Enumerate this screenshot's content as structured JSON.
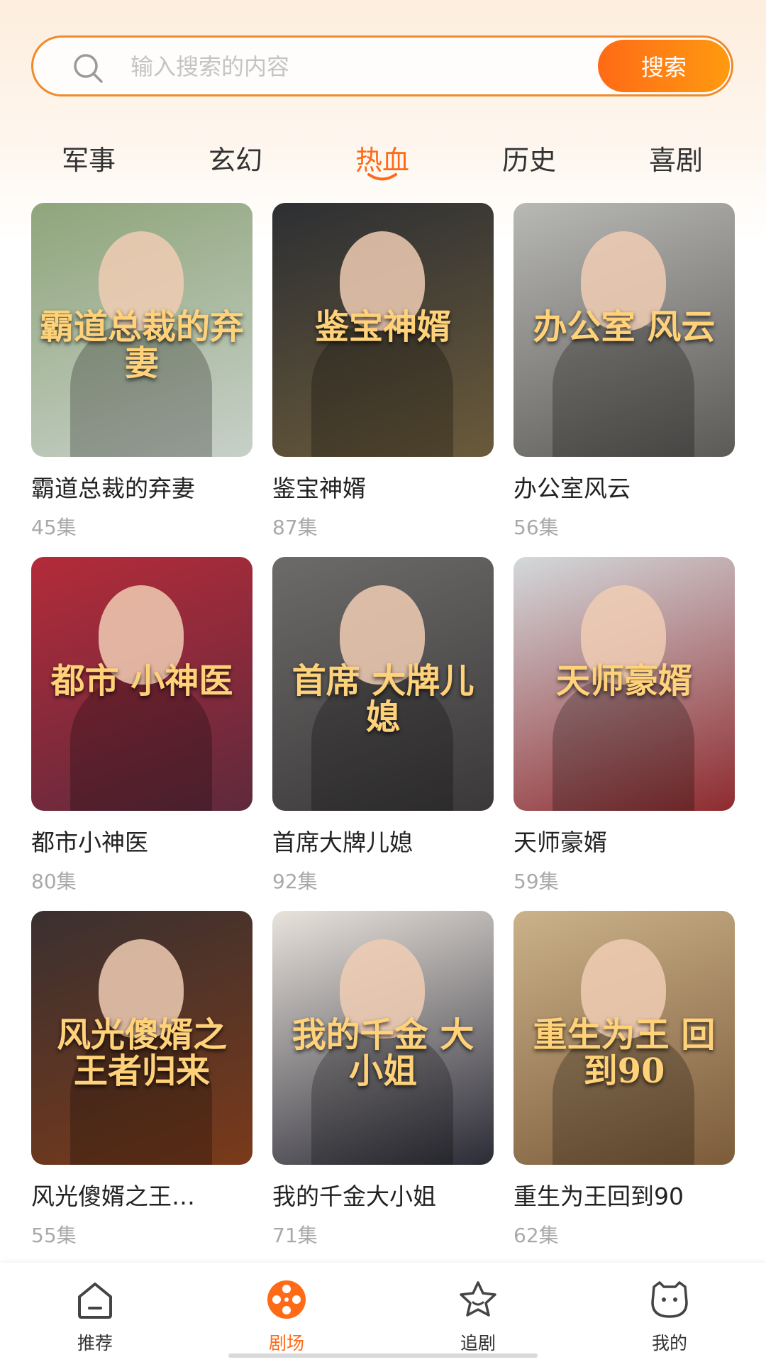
{
  "search": {
    "placeholder": "输入搜索的内容",
    "button_label": "搜索"
  },
  "tabs": [
    {
      "label": "军事",
      "active": false
    },
    {
      "label": "玄幻",
      "active": false
    },
    {
      "label": "热血",
      "active": true
    },
    {
      "label": "历史",
      "active": false
    },
    {
      "label": "喜剧",
      "active": false
    }
  ],
  "dramas": [
    {
      "title": "霸道总裁的弃妻",
      "episodes": "45集",
      "poster_text": "霸道总裁的弃妻",
      "poster_colors": [
        "#8fa57b",
        "#c7d0c8"
      ]
    },
    {
      "title": "鉴宝神婿",
      "episodes": "87集",
      "poster_text": "鉴宝神婿",
      "poster_colors": [
        "#2d2f33",
        "#6a5a3a"
      ]
    },
    {
      "title": "办公室风云",
      "episodes": "56集",
      "poster_text": "办公室 风云",
      "poster_colors": [
        "#b8b8b4",
        "#5c5a57"
      ]
    },
    {
      "title": "都市小神医",
      "episodes": "80集",
      "poster_text": "都市 小神医",
      "poster_colors": [
        "#b42b3a",
        "#5e2a3c"
      ]
    },
    {
      "title": "首席大牌儿媳",
      "episodes": "92集",
      "poster_text": "首席 大牌儿媳",
      "poster_colors": [
        "#6d6a6a",
        "#3a3838"
      ]
    },
    {
      "title": "天师豪婿",
      "episodes": "59集",
      "poster_text": "天师豪婿",
      "poster_colors": [
        "#d4d9dc",
        "#8e2b2f"
      ]
    },
    {
      "title": "风光傻婿之王…",
      "episodes": "55集",
      "poster_text": "风光傻婿之 王者归来",
      "poster_colors": [
        "#3a3030",
        "#7a3a1a"
      ]
    },
    {
      "title": "我的千金大小姐",
      "episodes": "71集",
      "poster_text": "我的千金 大小姐",
      "poster_colors": [
        "#e9e3dc",
        "#2b2b36"
      ]
    },
    {
      "title": "重生为王回到90",
      "episodes": "62集",
      "poster_text": "重生为王 回到90",
      "poster_colors": [
        "#cbb28a",
        "#7c5b3a"
      ]
    }
  ],
  "nav": [
    {
      "label": "推荐",
      "icon": "home-icon",
      "active": false
    },
    {
      "label": "剧场",
      "icon": "film-reel-icon",
      "active": true
    },
    {
      "label": "追剧",
      "icon": "star-icon",
      "active": false
    },
    {
      "label": "我的",
      "icon": "profile-face-icon",
      "active": false
    }
  ],
  "colors": {
    "accent": "#ff6a16",
    "accent_end": "#ff9a10",
    "muted": "#a9a9a9"
  }
}
